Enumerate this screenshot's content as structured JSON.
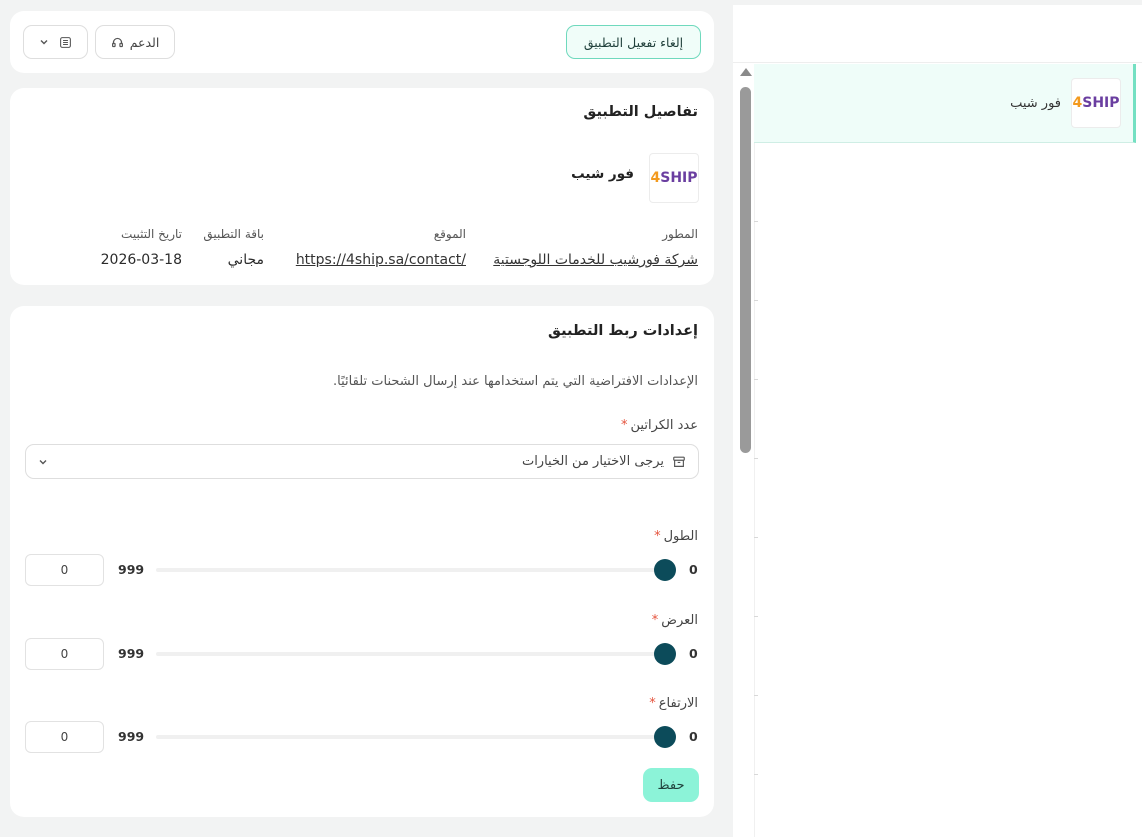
{
  "header": {
    "deactivate_label": "إلغاء تفعيل التطبيق",
    "support_label": "الدعم"
  },
  "sidebar": {
    "items": [
      {
        "logo_text_num": "4",
        "logo_text_word": "SHIP",
        "label": "فور شيب"
      }
    ]
  },
  "details": {
    "title": "تفاصيل التطبيق",
    "app_name": "فور شيب",
    "logo_text_num": "4",
    "logo_text_word": "SHIP",
    "developer_label": "المطور",
    "developer_value": "شركة فورشيب للخدمات اللوجستية",
    "website_label": "الموقع",
    "website_value": "https://4ship.sa/contact/",
    "plan_label": "باقة التطبيق",
    "plan_value": "مجاني",
    "install_label": "تاريخ التثبيت",
    "install_value": "2026-03-18"
  },
  "settings": {
    "title": "إعدادات ربط التطبيق",
    "description": "الإعدادات الافتراضية التي يتم استخدامها عند إرسال الشحنات تلقائيًا.",
    "boxes_label": "عدد الكراتين",
    "boxes_placeholder": "يرجى الاختيار من الخيارات",
    "required_mark": "*",
    "sliders": [
      {
        "label": "الطول",
        "min": "0",
        "max": "999",
        "value": "0"
      },
      {
        "label": "العرض",
        "min": "0",
        "max": "999",
        "value": "0"
      },
      {
        "label": "الارتفاع",
        "min": "0",
        "max": "999",
        "value": "0"
      }
    ],
    "save_label": "حفظ"
  },
  "colors": {
    "accent": "#8cf3d8",
    "accent_border": "#6fd9bd",
    "slider_thumb": "#0c4b5a",
    "required": "#e5533d"
  }
}
